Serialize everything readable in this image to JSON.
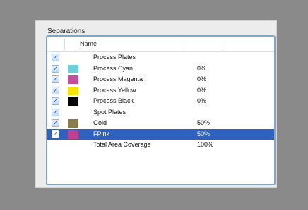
{
  "panel": {
    "title": "Separations"
  },
  "list": {
    "column_header": "Name",
    "rows": [
      {
        "checked": true,
        "swatch": null,
        "label": "Process Plates",
        "value": "",
        "selected": false
      },
      {
        "checked": true,
        "swatch": "#6ccfdc",
        "label": "Process Cyan",
        "value": "0%",
        "selected": false
      },
      {
        "checked": true,
        "swatch": "#c24f9f",
        "label": "Process Magenta",
        "value": "0%",
        "selected": false
      },
      {
        "checked": true,
        "swatch": "#f5e500",
        "label": "Process Yellow",
        "value": "0%",
        "selected": false
      },
      {
        "checked": true,
        "swatch": "#050505",
        "label": "Process Black",
        "value": "0%",
        "selected": false
      },
      {
        "checked": true,
        "swatch": null,
        "label": "Spot Plates",
        "value": "",
        "selected": false
      },
      {
        "checked": true,
        "swatch": "#8b7a4e",
        "label": "Gold",
        "value": "50%",
        "selected": false
      },
      {
        "checked": true,
        "swatch": "#c23f93",
        "label": "FPink",
        "value": "50%",
        "selected": true
      },
      {
        "checked": false,
        "swatch": null,
        "label": "Total Area Coverage",
        "value": "100%",
        "selected": false
      }
    ]
  },
  "colors": {
    "selection": "#2f62c0",
    "focus_border": "#7fa5d6"
  }
}
